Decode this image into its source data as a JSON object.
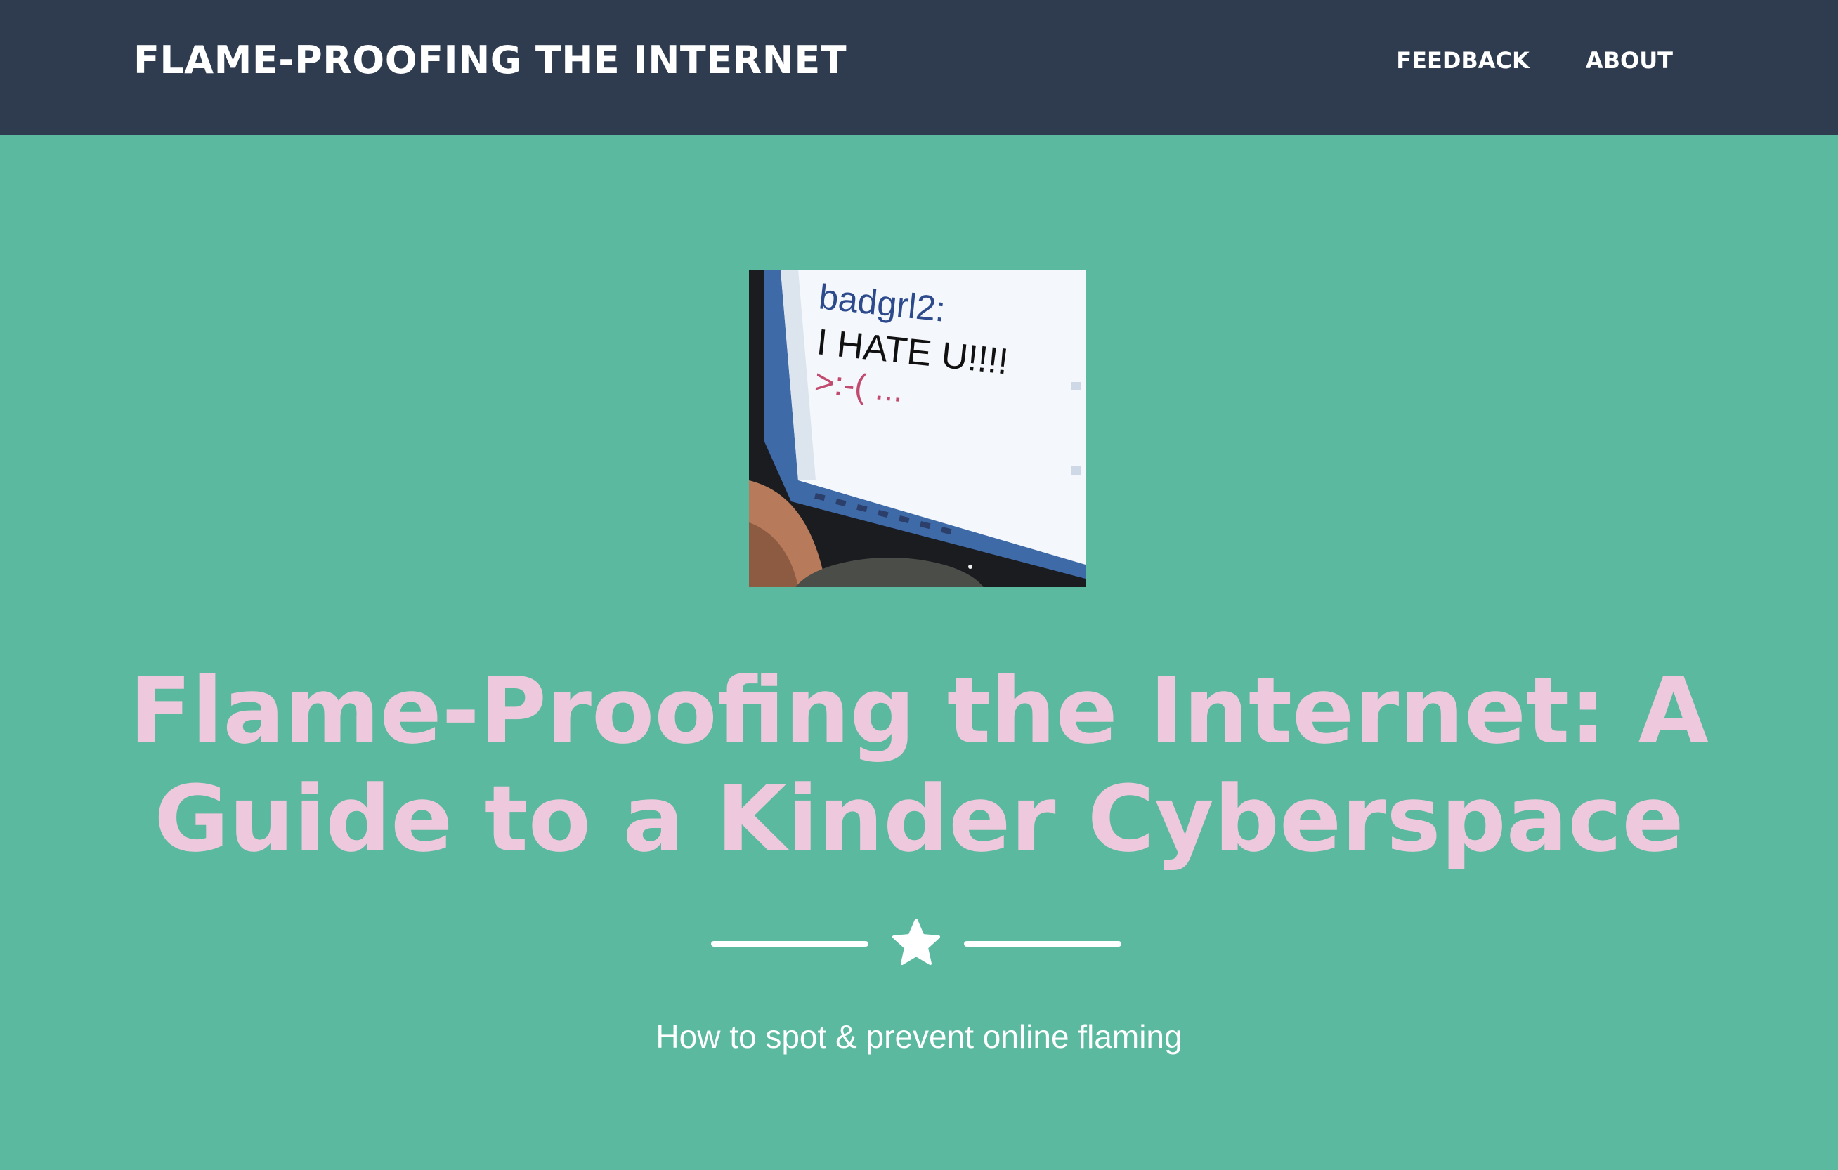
{
  "navbar": {
    "brand": "FLAME-PROOFING THE INTERNET",
    "links": [
      {
        "label": "FEEDBACK"
      },
      {
        "label": "ABOUT"
      }
    ],
    "background_color": "#2f3c50"
  },
  "hero": {
    "background_color": "#5ab99e",
    "image": {
      "screen_name": "badgrl2:",
      "screen_message": "I HATE U!!!!",
      "screen_emote": ">:-( ..."
    },
    "title": "Flame-Proofing the Internet: A Guide to a Kinder Cyberspace",
    "title_color": "#eec8dc",
    "divider_icon": "star-icon",
    "subtitle": "How to spot & prevent online flaming"
  }
}
